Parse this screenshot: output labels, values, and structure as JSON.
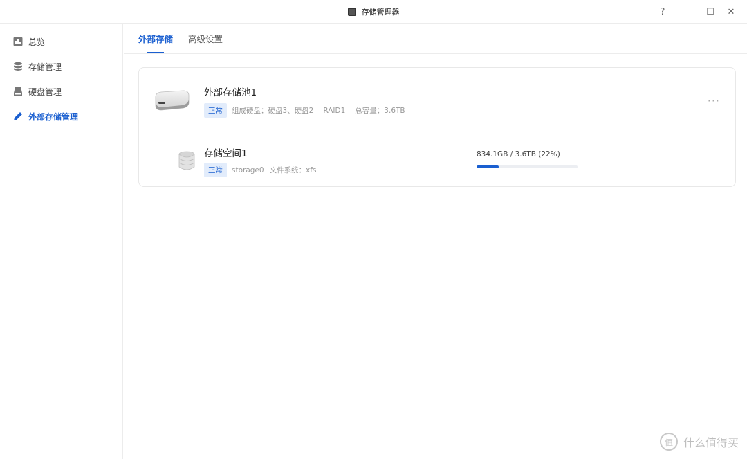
{
  "window": {
    "title": "存储管理器",
    "controls": {
      "help": "?",
      "minimize": "—",
      "maximize": "☐",
      "close": "✕"
    }
  },
  "sidebar": {
    "items": [
      {
        "label": "总览",
        "icon": "chart-bar-icon",
        "active": false
      },
      {
        "label": "存储管理",
        "icon": "database-icon",
        "active": false
      },
      {
        "label": "硬盘管理",
        "icon": "hard-drive-icon",
        "active": false
      },
      {
        "label": "外部存储管理",
        "icon": "pencil-icon",
        "active": true
      }
    ]
  },
  "tabs": [
    {
      "label": "外部存储",
      "active": true
    },
    {
      "label": "高级设置",
      "active": false
    }
  ],
  "pool": {
    "name": "外部存储池1",
    "status": "正常",
    "disks": "组成硬盘：硬盘3、硬盘2",
    "raid": "RAID1",
    "capacity": "总容量：3.6TB",
    "more": "···"
  },
  "space": {
    "name": "存储空间1",
    "status": "正常",
    "device": "storage0",
    "filesystem": "文件系统：xfs",
    "usage_text": "834.1GB / 3.6TB (22%)",
    "usage_fraction": 0.22
  },
  "watermark": {
    "logo": "值",
    "text": "什么值得买"
  },
  "colors": {
    "accent": "#1a5fd0",
    "badge_bg": "#e2ecfb"
  }
}
